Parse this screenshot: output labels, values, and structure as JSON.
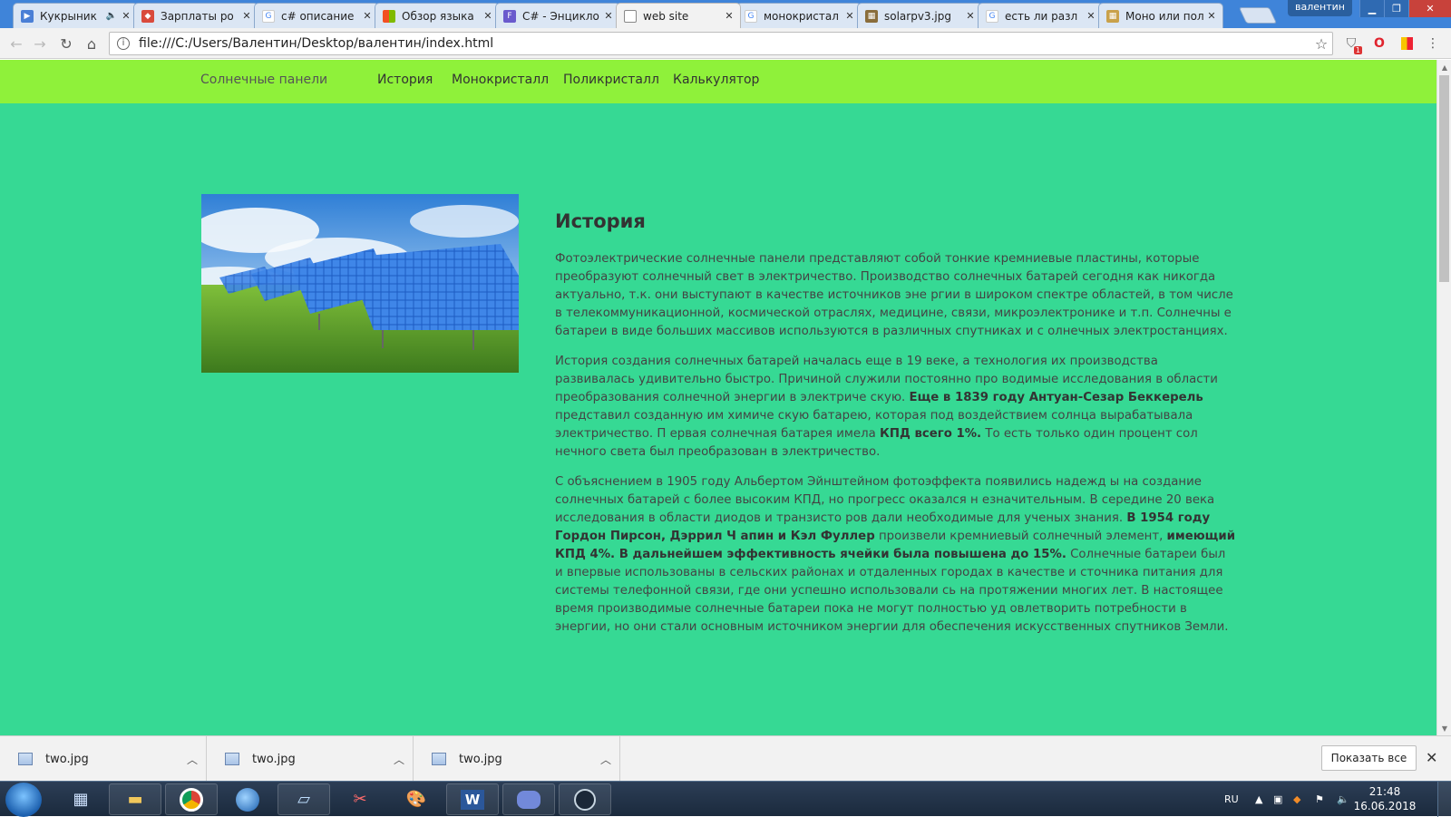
{
  "browser": {
    "tabs": [
      {
        "label": "Кукрыник",
        "icon": "video-icon",
        "has_sound": true
      },
      {
        "label": "Зарплаты ро",
        "icon": "site-icon"
      },
      {
        "label": "c# описание",
        "icon": "google-icon"
      },
      {
        "label": "Обзор языка",
        "icon": "microsoft-icon"
      },
      {
        "label": "C# - Энцикло",
        "icon": "site-icon"
      },
      {
        "label": "web site",
        "icon": "page-icon",
        "active": true
      },
      {
        "label": "монокристал",
        "icon": "google-icon"
      },
      {
        "label": "solarpv3.jpg",
        "icon": "image-icon"
      },
      {
        "label": "есть ли разл",
        "icon": "google-icon"
      },
      {
        "label": "Моно или пол",
        "icon": "site-icon"
      }
    ],
    "profile_name": "валентин",
    "url": "file:///C:/Users/Валентин/Desktop/валентин/index.html",
    "extension_badge": "1"
  },
  "page": {
    "brand": "Солнечные панели",
    "nav": [
      "История",
      "Монокристалл",
      "Поликристалл",
      "Калькулятор"
    ],
    "title": "История",
    "p1": "Фотоэлектрические солнечные панели представляют собой тонкие кремниевые пластины, которые преобразуют солнечный свет в электричество. Производство солнечных батарей сегодня как никогда актуально, т.к. они выступают в качестве источников эне ргии в широком спектре областей, в том числе в телекоммуникационной, космической отраслях, медицине, связи, микроэлектронике и т.п. Солнечны е батареи в виде больших массивов используются в различных спутниках и с олнечных электростанциях.",
    "p2_a": "История создания солнечных батарей началась еще в 19 веке, а технология их производства развивалась удивительно быстро. Причиной служили постоянно про водимые исследования в области преобразования солнечной энергии в электриче скую. ",
    "p2_b1": "Еще в 1839 году Антуан-Сезар Беккерель",
    "p2_c": " представил созданную им химиче скую батарею, которая под воздействием солнца вырабатывала электричество. П ервая солнечная батарея имела ",
    "p2_b2": "КПД всего 1%.",
    "p2_d": " То есть только один процент сол нечного света был преобразован в электричество.",
    "p3_a": "С объяснением в 1905 году Альбертом Эйнштейном фотоэффекта появились надежд ы на создание солнечных батарей с более высоким КПД, но прогресс оказался н езначительным. В середине 20 века исследования в области диодов и транзисто ров дали необходимые для ученых знания. ",
    "p3_b1": "В 1954 году Гордон Пирсон, Дэррил Ч апин и Кэл Фуллер",
    "p3_c": " произвели кремниевый солнечный элемент, ",
    "p3_b2": "имеющий КПД 4%. В дальнейшем эффективность ячейки была повышена до 15%.",
    "p3_d": " Солнечные батареи был и впервые использованы в сельских районах и отдаленных городах в качестве и сточника питания для системы телефонной связи, где они успешно использовали сь на протяжении многих лет. В настоящее время производимые солнечные батареи пока не могут полностью уд овлетворить потребности в энергии, но они стали основным источником энергии для обеспечения искусственных спутников Земли."
  },
  "downloads": {
    "items": [
      "two.jpg",
      "two.jpg",
      "two.jpg"
    ],
    "show_all": "Показать все"
  },
  "taskbar": {
    "lang": "RU",
    "time": "21:48",
    "date": "16.06.2018"
  },
  "colors": {
    "navbar": "#8ff13a",
    "page_bg": "#36d994"
  }
}
